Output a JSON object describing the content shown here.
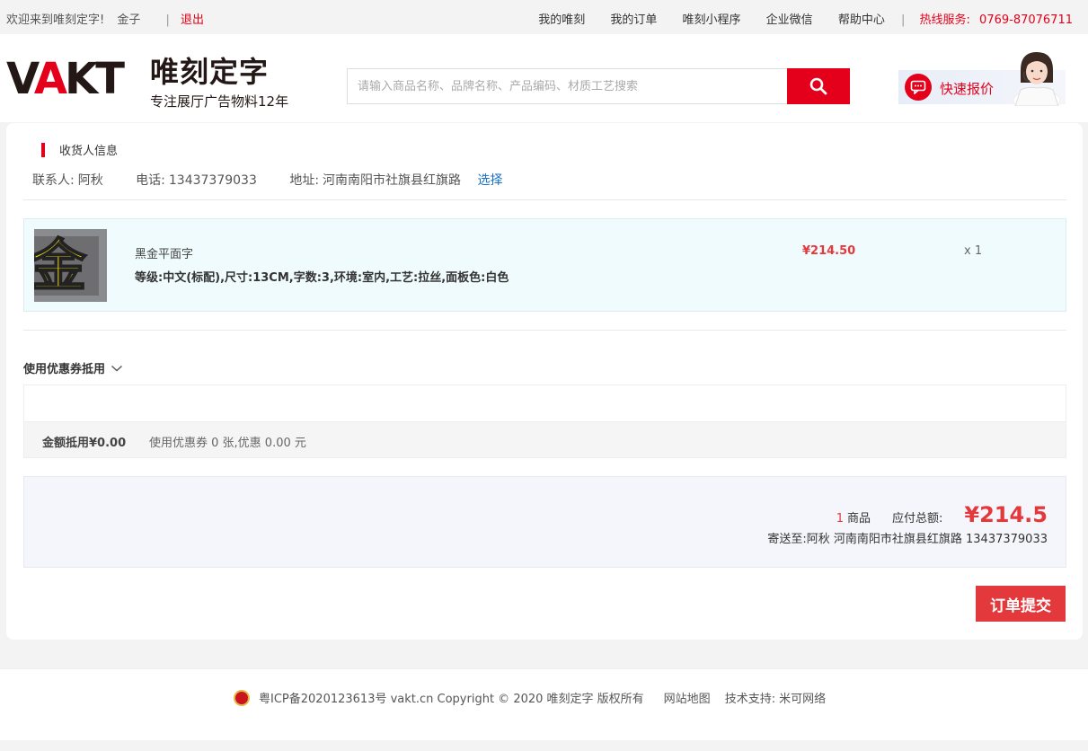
{
  "topbar": {
    "welcome": "欢迎来到唯刻定字!",
    "username": "金子",
    "logout": "退出",
    "nav": [
      "我的唯刻",
      "我的订单",
      "唯刻小程序",
      "企业微信",
      "帮助中心"
    ],
    "hotline_label": "热线服务:",
    "hotline_number": "0769-87076711"
  },
  "header": {
    "logo_en_prefix": "V",
    "logo_en_a": "A",
    "logo_en_suffix": "KT",
    "logo_cn": "唯刻定字",
    "slogan": "专注展厅广告物料12年",
    "search_placeholder": "请输入商品名称、品牌名称、产品编码、材质工艺搜索",
    "quote_label": "快速报价"
  },
  "consignee": {
    "section_title": "收货人信息",
    "contact_label": "联系人:",
    "contact_name": "阿秋",
    "phone_label": "电话:",
    "phone": "13437379033",
    "address_label": "地址:",
    "address": "河南南阳市社旗县红旗路",
    "select_link": "选择"
  },
  "order_item": {
    "thumb_text": "金",
    "name": "黑金平面字",
    "spec": "等级:中文(标配),尺寸:13CM,字数:3,环境:室内,工艺:拉丝,面板色:白色",
    "price": "¥214.50",
    "quantity": "x 1"
  },
  "coupon": {
    "toggle_label": "使用优惠券抵用",
    "amount_deduct": "金额抵用¥0.00",
    "usage_info": "使用优惠券 0 张,优惠 0.00 元"
  },
  "summary": {
    "item_count": "1",
    "item_unit": "商品",
    "total_label": "应付总额:",
    "total": "¥214.5",
    "ship_to": "寄送至:阿秋 河南南阳市社旗县红旗路 13437379033"
  },
  "submit_label": "订单提交",
  "footer": {
    "icp": "粤ICP备2020123613号 vakt.cn Copyright © 2020 唯刻定字 版权所有",
    "sitemap": "网站地图",
    "support_label": "技术支持:",
    "support_name": "米可网络"
  },
  "colors": {
    "accent_red": "#e4001b",
    "price_red": "#e4393c",
    "link_blue": "#1a73c8",
    "item_bg": "#effbfd"
  }
}
